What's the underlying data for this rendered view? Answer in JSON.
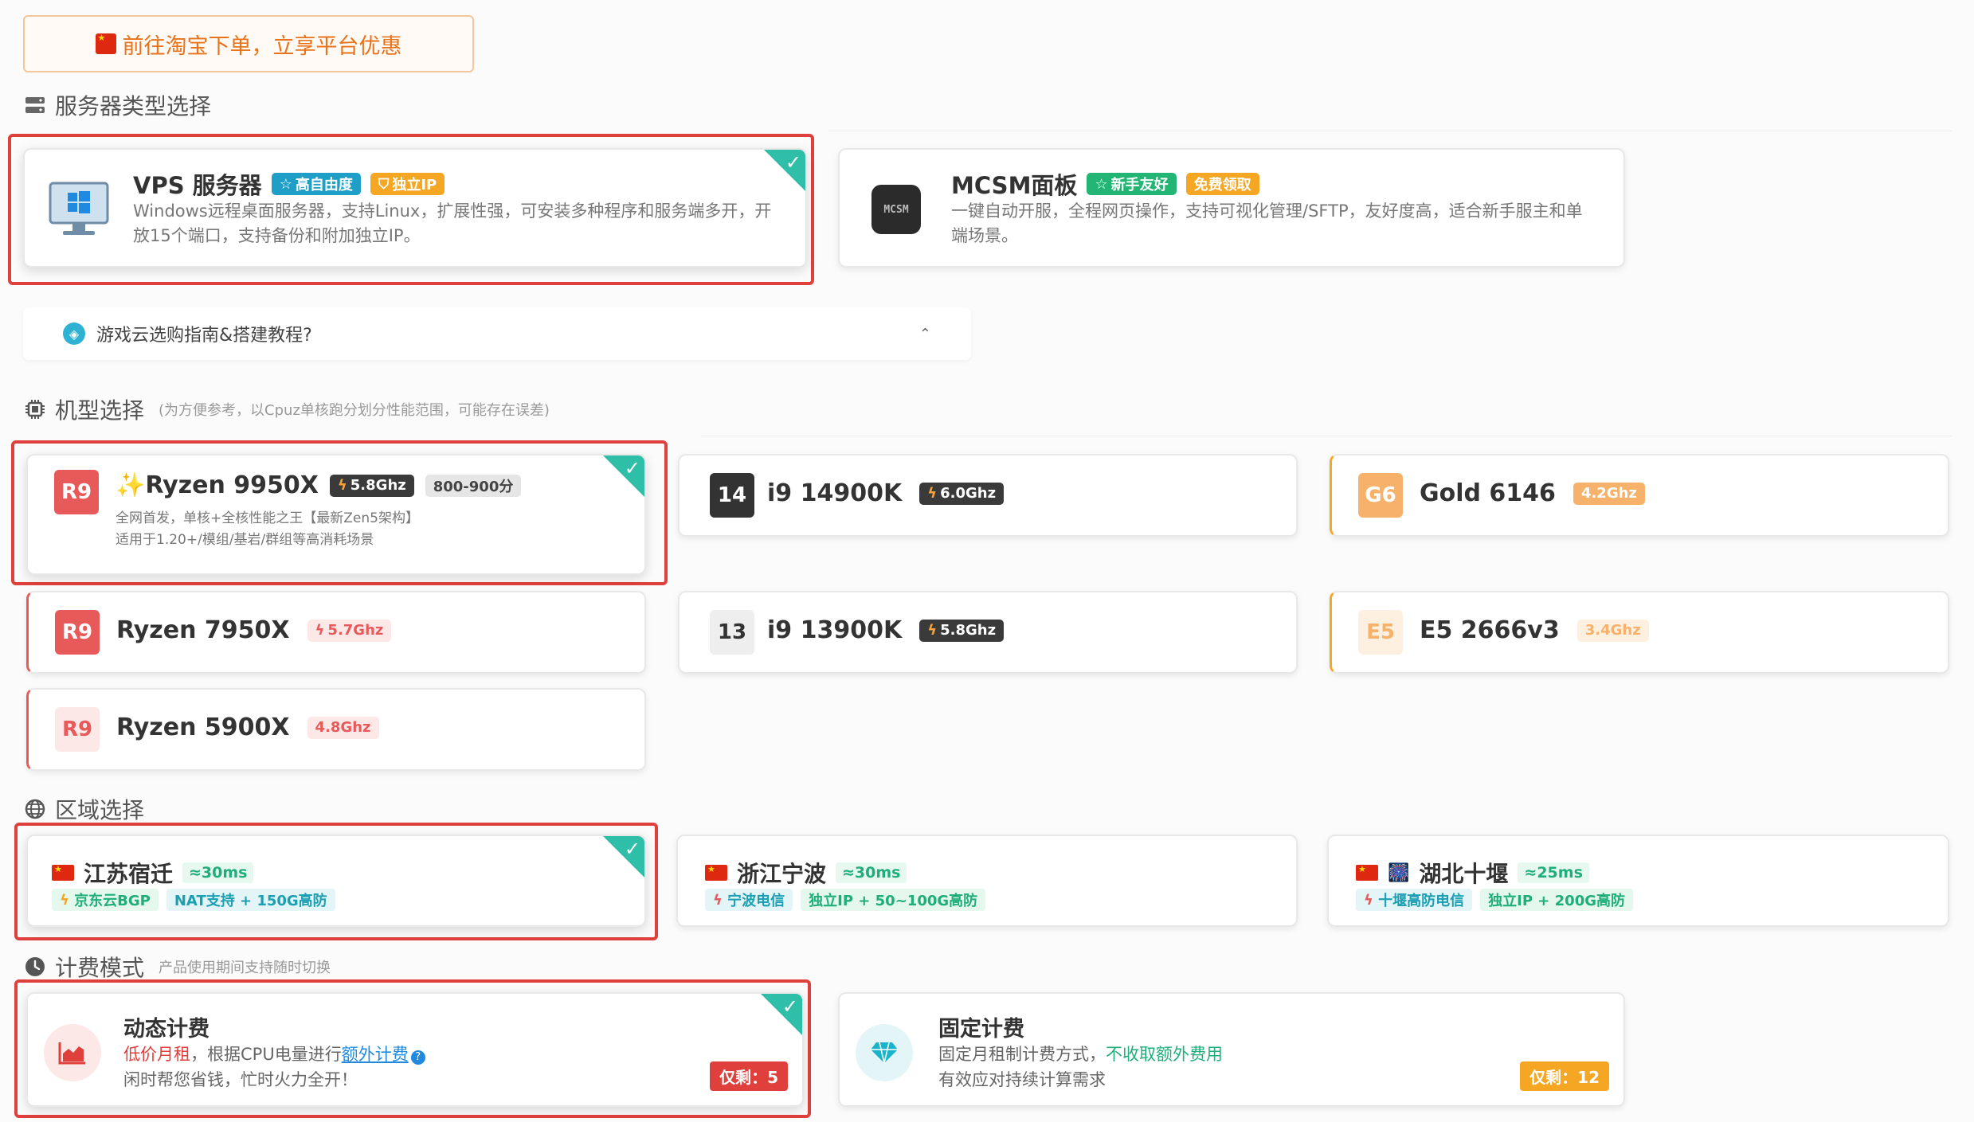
{
  "taobao_button": "前往淘宝下单，立享平台优惠",
  "server_type": {
    "title": "服务器类型选择",
    "vps": {
      "name": "VPS 服务器",
      "badge1": "高自由度",
      "badge2": "独立IP",
      "desc1": "Windows远程桌面服务器，支持Linux，扩展性强，可安装多种程序和服务端多开，开",
      "desc2": "放15个端口，支持备份和附加独立IP。"
    },
    "mcsm": {
      "name": "MCSM面板",
      "icon_text": "MCSM",
      "badge1": "新手友好",
      "badge2": "免费领取",
      "desc1": "一键自动开服，全程网页操作，支持可视化管理/SFTP，友好度高，适合新手服主和单",
      "desc2": "端场景。"
    }
  },
  "guide": {
    "label": "游戏云选购指南&搭建教程?"
  },
  "cpu": {
    "title": "机型选择",
    "note": "(为方便参考，以Cpuz单核跑分划分性能范围，可能存在误差)",
    "items": [
      {
        "tag": "R9",
        "name": "Ryzen 9950X",
        "ghz": "5.8Ghz",
        "score": "800-900分",
        "desc1": "全网首发，单核+全核性能之王【最新Zen5架构】",
        "desc2": "适用于1.20+/模组/基岩/群组等高消耗场景"
      },
      {
        "tag": "14",
        "name": "i9 14900K",
        "ghz": "6.0Ghz"
      },
      {
        "tag": "G6",
        "name": "Gold 6146",
        "ghz": "4.2Ghz"
      },
      {
        "tag": "R9",
        "name": "Ryzen 7950X",
        "ghz": "5.7Ghz"
      },
      {
        "tag": "13",
        "name": "i9 13900K",
        "ghz": "5.8Ghz"
      },
      {
        "tag": "E5",
        "name": "E5 2666v3",
        "ghz": "3.4Ghz"
      },
      {
        "tag": "R9",
        "name": "Ryzen 5900X",
        "ghz": "4.8Ghz"
      }
    ]
  },
  "region": {
    "title": "区域选择",
    "items": [
      {
        "name": "江苏宿迁",
        "latency": "≈30ms",
        "line": "京东云BGP",
        "feature": "NAT支持 + 150G高防"
      },
      {
        "name": "浙江宁波",
        "latency": "≈30ms",
        "line": "宁波电信",
        "feature": "独立IP + 50~100G高防"
      },
      {
        "name": "湖北十堰",
        "latency": "≈25ms",
        "line": "十堰高防电信",
        "feature": "独立IP + 200G高防"
      }
    ]
  },
  "billing": {
    "title": "计费模式",
    "note": "产品使用期间支持随时切换",
    "dynamic": {
      "name": "动态计费",
      "line1_a": "低价月租",
      "line1_b": "，根据CPU电量进行",
      "line1_link": "额外计费",
      "line2": "闲时帮您省钱，忙时火力全开！",
      "stock": "仅剩：5"
    },
    "fixed": {
      "name": "固定计费",
      "line1_a": "固定月租制计费方式，",
      "line1_b": "不收取额外费用",
      "line2": "有效应对持续计算需求",
      "stock": "仅剩：12"
    }
  }
}
